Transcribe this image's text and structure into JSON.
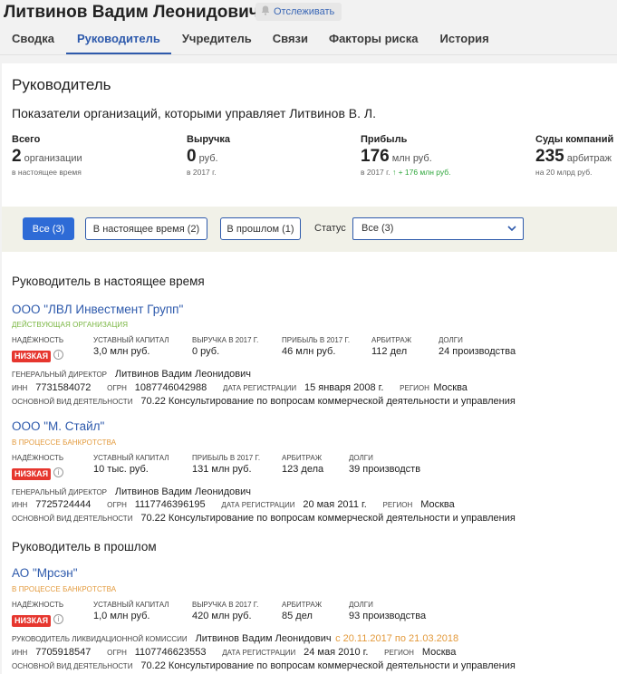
{
  "company_title": "Литвинов Вадим Леонидович",
  "follow_label": "Отслеживать",
  "tabs": [
    {
      "label": "Сводка"
    },
    {
      "label": "Руководитель"
    },
    {
      "label": "Учредитель"
    },
    {
      "label": "Связи"
    },
    {
      "label": "Факторы риска"
    },
    {
      "label": "История"
    }
  ],
  "page": {
    "title": "Руководитель",
    "subtitle": "Показатели организаций, которыми управляет Литвинов В. Л."
  },
  "stats": [
    {
      "label": "Всего",
      "value": "2",
      "unit": "организации",
      "note": "в настоящее время",
      "note_extra": ""
    },
    {
      "label": "Выручка",
      "value": "0",
      "unit": "руб.",
      "note": "в 2017 г.",
      "note_extra": ""
    },
    {
      "label": "Прибыль",
      "value": "176",
      "unit": "млн руб.",
      "note": "в 2017 г.",
      "note_extra": "↑ + 176 млн руб."
    },
    {
      "label": "Суды компаний",
      "value": "235",
      "unit": "арбитраж",
      "note": "на 20 млрд руб.",
      "note_extra": ""
    }
  ],
  "filters": {
    "buttons": [
      "Все (3)",
      "В настоящее время (2)",
      "В прошлом (1)"
    ],
    "status_label": "Статус",
    "status_value": "Все (3)"
  },
  "sections": {
    "current": "Руководитель в настоящее время",
    "past": "Руководитель в прошлом"
  },
  "labels": {
    "reliability": "надёжность",
    "capital": "уставный капитал",
    "revenue": "выручка в 2017 г.",
    "profit": "прибыль в 2017 г.",
    "arbitration": "арбитраж",
    "debts": "долги",
    "general_director": "генеральный директор",
    "liquidation_head": "руководитель ликвидационной комиссии",
    "inn": "ИНН",
    "ogrn": "ОГРН",
    "reg_date": "дата регистрации",
    "region": "регион",
    "main_activity": "основной вид деятельности"
  },
  "orgs": [
    {
      "name": "ООО \"ЛВЛ Инвестмент Групп\"",
      "status": "действующая организация",
      "reliability": "низкая",
      "capital": "3,0 млн руб.",
      "revenue": "0 руб.",
      "profit": "46 млн руб.",
      "arbitration": "112 дел",
      "debts": "24 производства",
      "director": "Литвинов Вадим Леонидович",
      "inn": "7731584072",
      "ogrn": "1087746042988",
      "reg_date": "15 января 2008 г.",
      "region": "Москва",
      "activity": "70.22 Консультирование по вопросам коммерческой деятельности и управления"
    },
    {
      "name": "ООО \"М. Стайл\"",
      "status": "в процессе банкротства",
      "reliability": "низкая",
      "capital": "10 тыс. руб.",
      "profit": "131 млн руб.",
      "arbitration": "123 дела",
      "debts": "39 производств",
      "director": "Литвинов Вадим Леонидович",
      "inn": "7725724444",
      "ogrn": "1117746396195",
      "reg_date": "20 мая 2011 г.",
      "region": "Москва",
      "activity": "70.22 Консультирование по вопросам коммерческой деятельности и управления"
    },
    {
      "name": "АО \"Мрсэн\"",
      "status": "в процессе банкротства",
      "reliability": "низкая",
      "capital": "1,0 млн руб.",
      "revenue": "420 млн руб.",
      "arbitration": "85 дел",
      "debts": "93 производства",
      "director": "Литвинов Вадим Леонидович",
      "period": "с 20.11.2017 по 21.03.2018",
      "inn": "7705918547",
      "ogrn": "1107746623553",
      "reg_date": "24 мая 2010 г.",
      "region": "Москва",
      "activity": "70.22 Консультирование по вопросам коммерческой деятельности и управления"
    }
  ],
  "colors": {
    "accent": "#2e5aac",
    "badge_low": "#e6362e",
    "status_active": "#79b641",
    "status_bankrupt": "#e39a3c",
    "positive": "#2ea63b"
  }
}
